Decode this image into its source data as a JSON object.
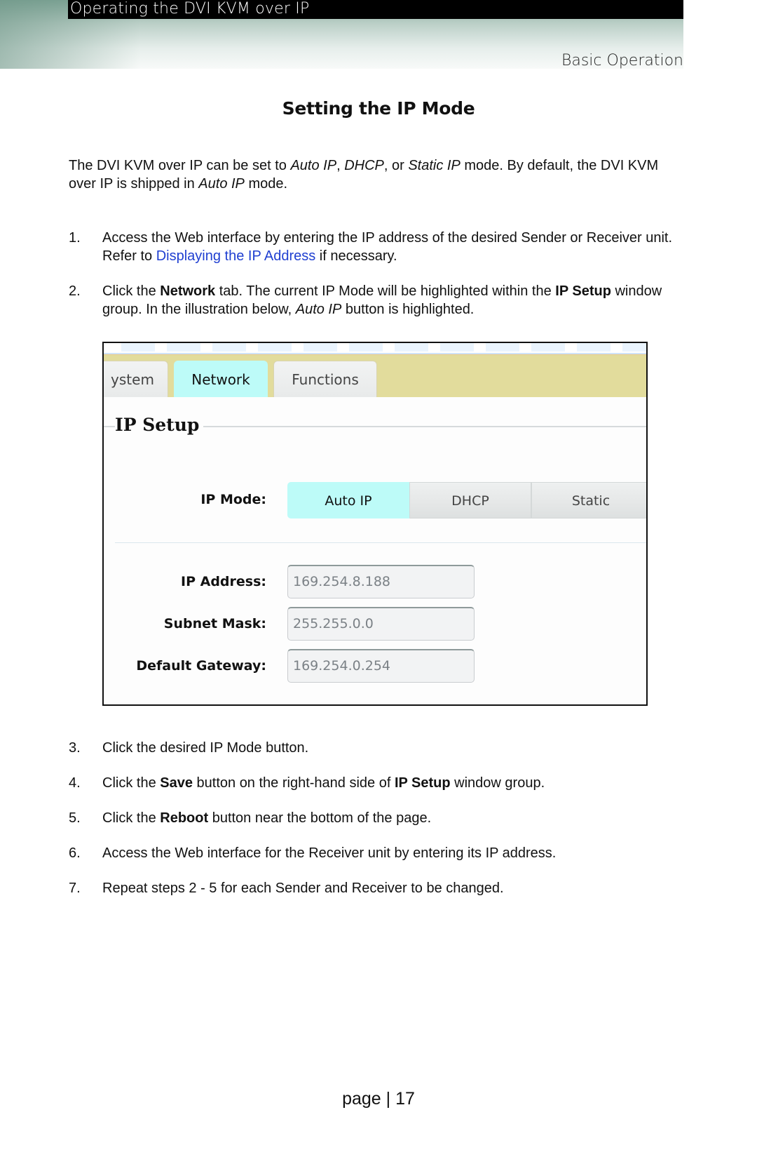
{
  "header": {
    "chapter": "Operating the DVI KVM over IP",
    "section": "Basic Operation"
  },
  "title": "Setting the IP Mode",
  "intro": {
    "t1": "The DVI KVM over IP can be set to ",
    "m1": "Auto IP",
    "t2": ", ",
    "m2": "DHCP",
    "t3": ", or ",
    "m3": "Static IP",
    "t4": " mode.  By default, the DVI KVM over IP is shipped in ",
    "m4": "Auto IP",
    "t5": " mode."
  },
  "steps": {
    "s1": {
      "num": "1.",
      "a": "Access the Web interface by entering the IP address of the desired Sender or Receiver unit.  Refer to ",
      "link": "Displaying the IP Address",
      "b": " if necessary."
    },
    "s2": {
      "num": "2.",
      "a": "Click the ",
      "b1": "Network",
      "c": " tab.  The current IP Mode will be highlighted within the ",
      "b2": "IP Setup",
      "d": " window group.  In the illustration below, ",
      "i1": "Auto IP",
      "e": " button is highlighted."
    },
    "s3": {
      "num": "3.",
      "a": "Click the desired IP Mode button."
    },
    "s4": {
      "num": "4.",
      "a": "Click the ",
      "b1": "Save",
      "c": " button on the right-hand side of ",
      "b2": "IP Setup",
      "d": " window group."
    },
    "s5": {
      "num": "5.",
      "a": "Click the ",
      "b1": "Reboot",
      "c": " button near the bottom of the page."
    },
    "s6": {
      "num": "6.",
      "a": "Access the Web interface for the Receiver unit by entering its IP address."
    },
    "s7": {
      "num": "7.",
      "a": "Repeat steps 2 - 5 for each Sender and Receiver to be changed."
    }
  },
  "figure": {
    "tabs": [
      {
        "label": "ystem",
        "active": false
      },
      {
        "label": "Network",
        "active": true
      },
      {
        "label": "Functions",
        "active": false
      }
    ],
    "group_title": "IP Setup",
    "ip_mode_label": "IP Mode:",
    "ip_modes": [
      {
        "label": "Auto IP",
        "active": true
      },
      {
        "label": "DHCP",
        "active": false
      },
      {
        "label": "Static",
        "active": false
      }
    ],
    "fields": [
      {
        "label": "IP Address:",
        "value": "169.254.8.188"
      },
      {
        "label": "Subnet Mask:",
        "value": "255.255.0.0"
      },
      {
        "label": "Default Gateway:",
        "value": "169.254.0.254"
      }
    ],
    "colors": {
      "active_highlight": "#bdfbf8",
      "tabbar": "#e2dc9c"
    }
  },
  "footer": {
    "page": "page | 17"
  }
}
